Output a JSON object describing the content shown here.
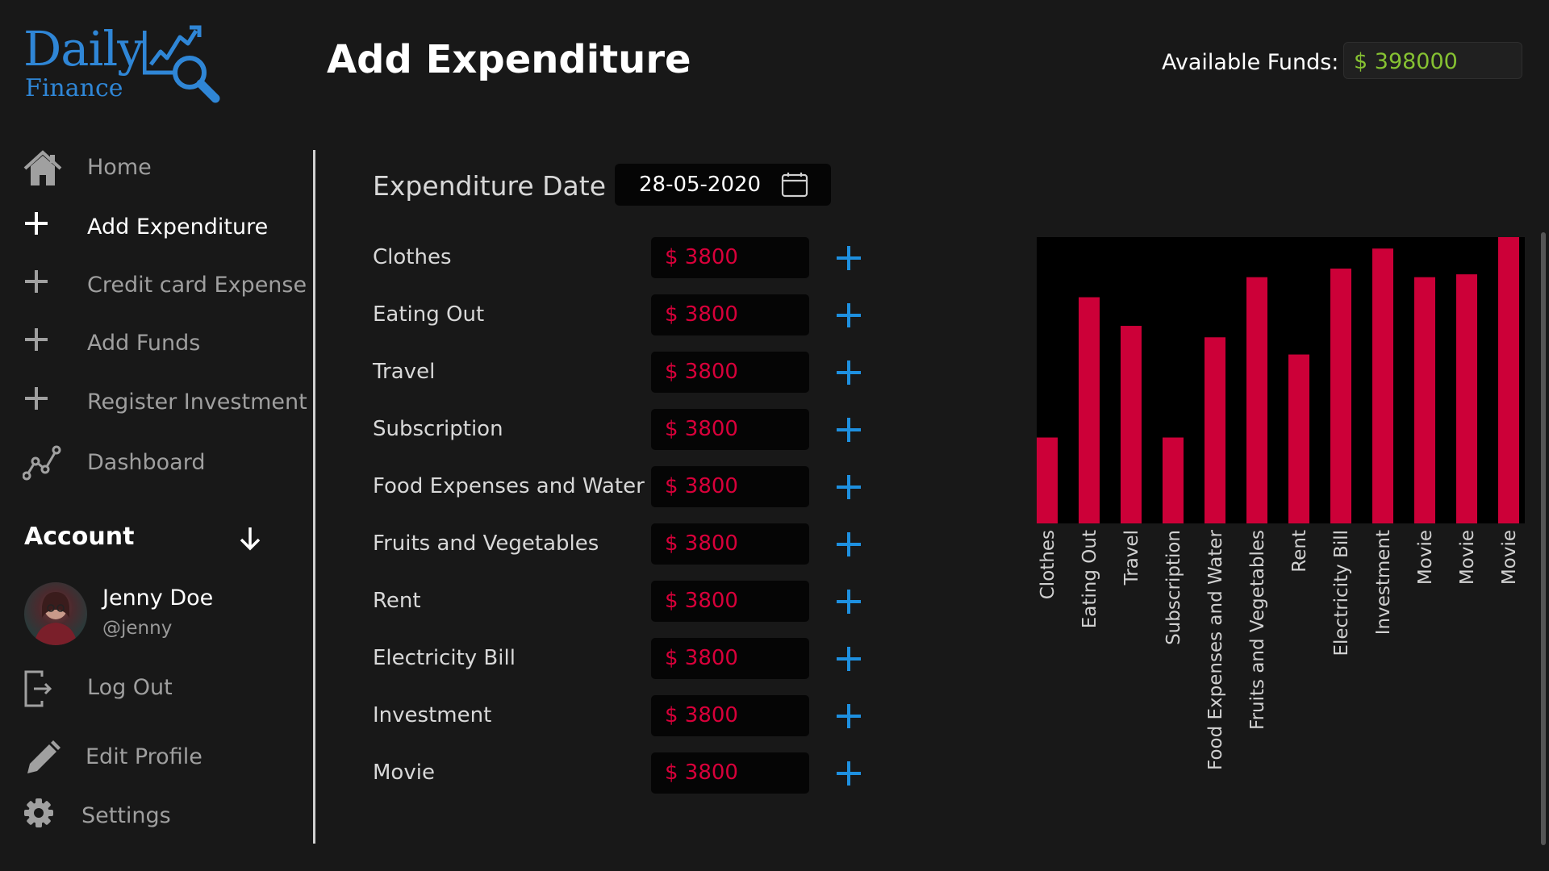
{
  "app": {
    "logo_word1": "Daily",
    "logo_word2": "Finance",
    "page_title": "Add Expenditure",
    "funds_label": "Available Funds:",
    "funds_value": "$ 398000"
  },
  "colors": {
    "background": "#181818",
    "accent_blue": "#1e90e0",
    "amount_red": "#d8003a",
    "bar_red": "#cc0038",
    "funds_green": "#86c232"
  },
  "sidebar": {
    "items": [
      {
        "label": "Home",
        "icon": "home-icon"
      },
      {
        "label": "Add Expenditure",
        "icon": "plus-icon",
        "active": true
      },
      {
        "label": "Credit card Expense",
        "icon": "plus-icon"
      },
      {
        "label": "Add Funds",
        "icon": "plus-icon"
      },
      {
        "label": "Register Investment",
        "icon": "plus-icon"
      },
      {
        "label": "Dashboard",
        "icon": "chart-line-icon"
      }
    ],
    "account": {
      "title": "Account",
      "user_name": "Jenny Doe",
      "user_handle": "@jenny",
      "actions": [
        {
          "label": "Log Out",
          "icon": "logout-icon"
        },
        {
          "label": "Edit Profile",
          "icon": "pencil-icon"
        },
        {
          "label": "Settings",
          "icon": "gear-icon"
        }
      ]
    }
  },
  "form": {
    "date_label": "Expenditure Date",
    "date_value": "28-05-2020",
    "rows": [
      {
        "label": "Clothes",
        "amount": "$ 3800"
      },
      {
        "label": "Eating Out",
        "amount": "$ 3800"
      },
      {
        "label": "Travel",
        "amount": "$ 3800"
      },
      {
        "label": "Subscription",
        "amount": "$ 3800"
      },
      {
        "label": "Food Expenses and Water",
        "amount": "$ 3800"
      },
      {
        "label": "Fruits and Vegetables",
        "amount": "$ 3800"
      },
      {
        "label": "Rent",
        "amount": "$ 3800"
      },
      {
        "label": "Electricity Bill",
        "amount": "$ 3800"
      },
      {
        "label": "Investment",
        "amount": "$ 3800"
      },
      {
        "label": "Movie",
        "amount": "$ 3800"
      }
    ]
  },
  "chart_data": {
    "type": "bar",
    "categories": [
      "Clothes",
      "Eating Out",
      "Travel",
      "Subscription",
      "Food Expenses and Water",
      "Fruits and Vegetables",
      "Rent",
      "Electricity Bill",
      "Investment",
      "Movie",
      "Movie",
      "Movie"
    ],
    "values": [
      30,
      79,
      69,
      30,
      65,
      86,
      59,
      89,
      96,
      86,
      87,
      100
    ],
    "ylim": [
      0,
      100
    ],
    "grid": false,
    "legend": "none",
    "title": "",
    "xlabel": "",
    "ylabel": ""
  }
}
